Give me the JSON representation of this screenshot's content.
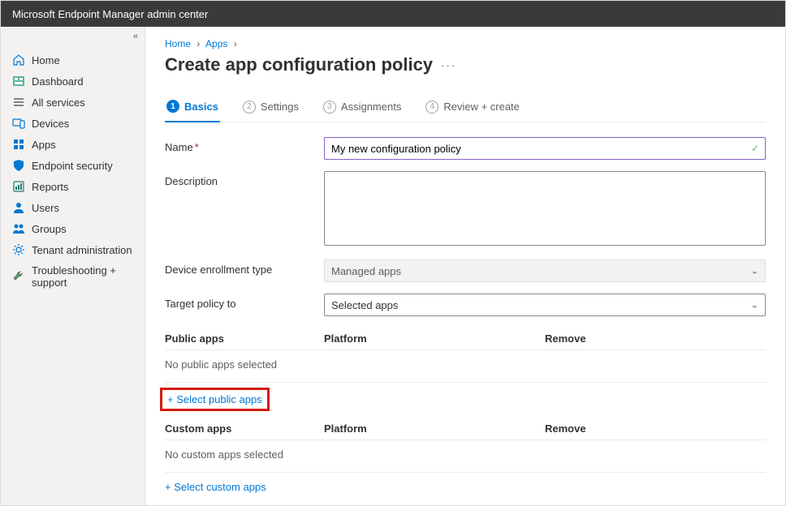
{
  "topbar": {
    "title": "Microsoft Endpoint Manager admin center"
  },
  "sidebar": {
    "items": [
      {
        "label": "Home"
      },
      {
        "label": "Dashboard"
      },
      {
        "label": "All services"
      },
      {
        "label": "Devices"
      },
      {
        "label": "Apps"
      },
      {
        "label": "Endpoint security"
      },
      {
        "label": "Reports"
      },
      {
        "label": "Users"
      },
      {
        "label": "Groups"
      },
      {
        "label": "Tenant administration"
      },
      {
        "label": "Troubleshooting + support"
      }
    ]
  },
  "breadcrumbs": {
    "a": "Home",
    "b": "Apps"
  },
  "page": {
    "title": "Create app configuration policy"
  },
  "tabs": {
    "t1": {
      "num": "1",
      "label": "Basics"
    },
    "t2": {
      "num": "2",
      "label": "Settings"
    },
    "t3": {
      "num": "3",
      "label": "Assignments"
    },
    "t4": {
      "num": "4",
      "label": "Review + create"
    }
  },
  "form": {
    "name_label": "Name",
    "name_value": "My new configuration policy",
    "desc_label": "Description",
    "desc_value": "",
    "det_label": "Device enrollment type",
    "det_value": "Managed apps",
    "tpt_label": "Target policy to",
    "tpt_value": "Selected apps"
  },
  "grid": {
    "public_head": "Public apps",
    "platform_head": "Platform",
    "remove_head": "Remove",
    "public_empty": "No public apps selected",
    "select_public": "+ Select public apps",
    "custom_head": "Custom apps",
    "custom_empty": "No custom apps selected",
    "select_custom": "+ Select custom apps"
  }
}
